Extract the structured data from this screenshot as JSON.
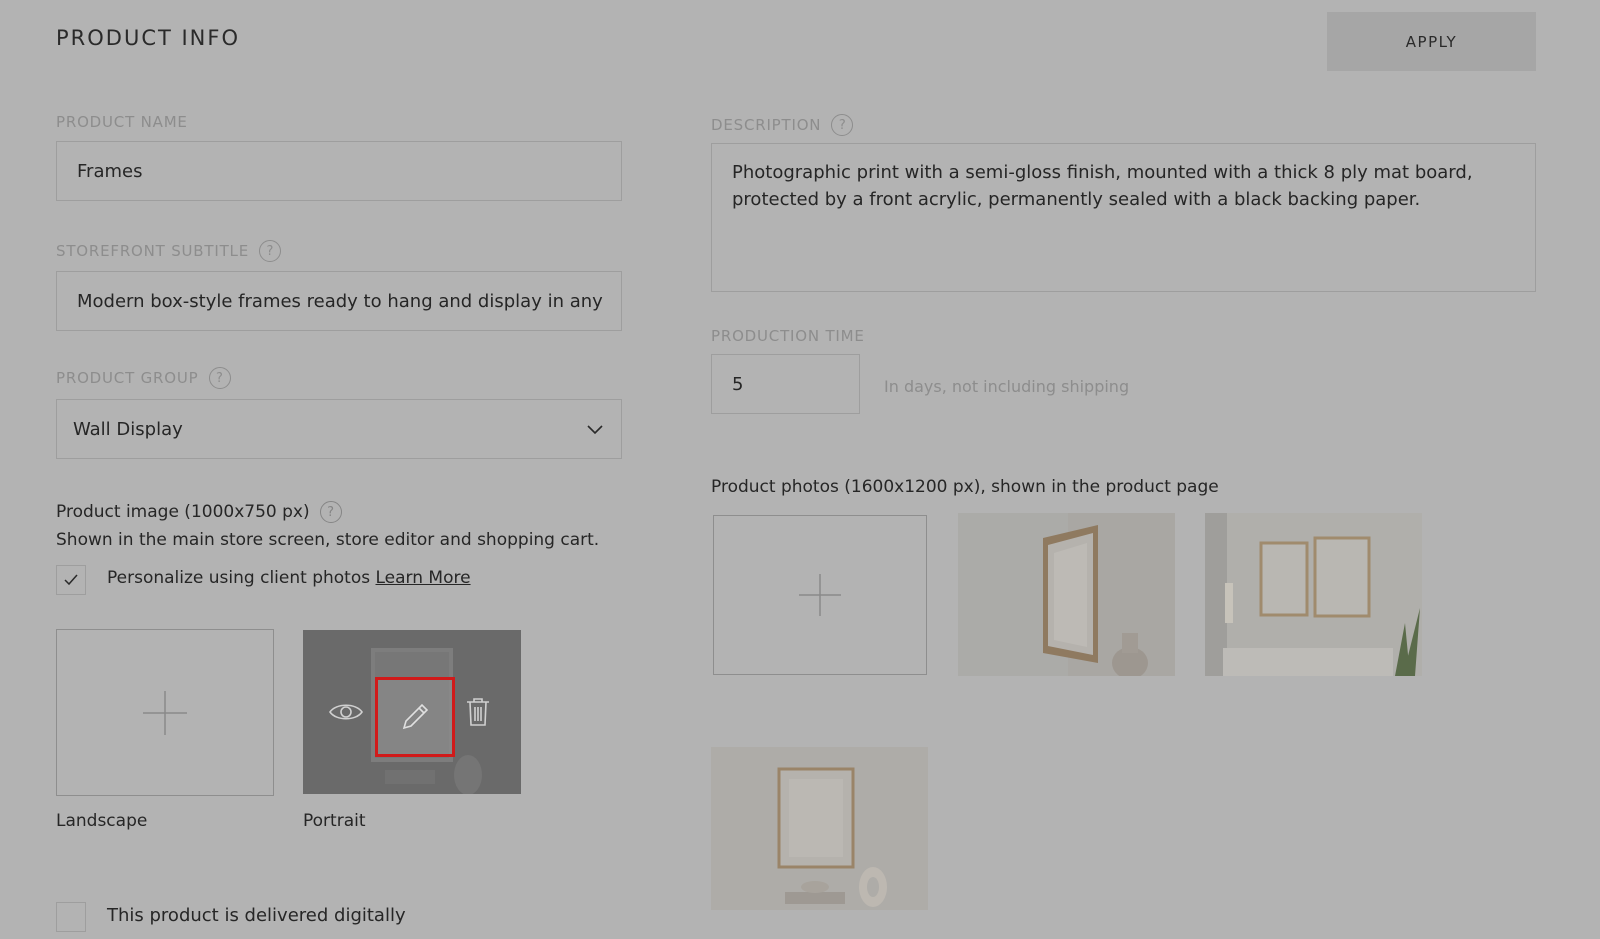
{
  "header": {
    "title": "PRODUCT INFO",
    "apply_label": "APPLY"
  },
  "product_name": {
    "label": "PRODUCT NAME",
    "value": "Frames"
  },
  "storefront_subtitle": {
    "label": "STOREFRONT SUBTITLE",
    "value": "Modern box-style frames ready to hang and display in any"
  },
  "product_group": {
    "label": "PRODUCT GROUP",
    "value": "Wall Display"
  },
  "product_image": {
    "title": "Product image (1000x750 px)",
    "subtitle": "Shown in the main store screen, store editor and shopping cart.",
    "personalize_label": "Personalize using client photos",
    "learn_more": "Learn More",
    "personalize_checked": true,
    "landscape_label": "Landscape",
    "portrait_label": "Portrait"
  },
  "digital_delivery": {
    "label": "This product is delivered digitally",
    "checked": false
  },
  "description": {
    "label": "DESCRIPTION",
    "value": "Photographic print with a semi-gloss finish, mounted with a thick 8 ply mat board, protected by a front acrylic, permanently sealed with a black backing paper."
  },
  "production_time": {
    "label": "PRODUCTION TIME",
    "value": "5",
    "hint": "In days, not including shipping"
  },
  "product_photos": {
    "title": "Product photos (1600x1200 px), shown in the product page"
  },
  "icons": {
    "help": "?",
    "check": "check-icon",
    "chevron": "chevron-down-icon",
    "plus": "plus-icon",
    "eye": "eye-icon",
    "pencil": "pencil-icon",
    "trash": "trash-icon"
  },
  "colors": {
    "overlay_bg": "#b3b3b3",
    "highlight": "#d11a1a"
  }
}
